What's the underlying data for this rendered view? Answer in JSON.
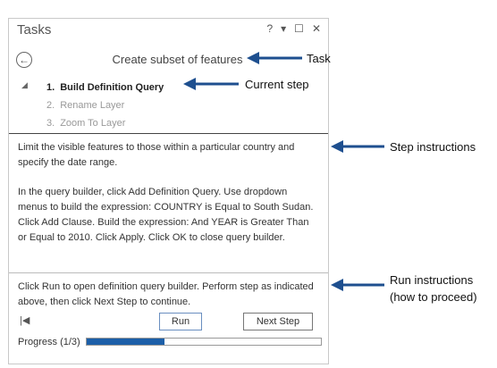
{
  "pane": {
    "title": "Tasks",
    "controls": {
      "help": "?",
      "menu": "▾",
      "maximize": "☐",
      "close": "✕"
    },
    "back_glyph": "←",
    "task_title": "Create subset of features",
    "steps": [
      {
        "number": "1.",
        "label": "Build Definition Query"
      },
      {
        "number": "2.",
        "label": "Rename Layer"
      },
      {
        "number": "3.",
        "label": "Zoom To Layer"
      }
    ],
    "current_step": 1,
    "instructions": [
      "Limit the visible features to those within a particular country and specify the date range.",
      "In the query builder, click Add Definition Query. Use dropdown menus to build the expression: COUNTRY is Equal to South Sudan. Click Add Clause. Build the expression: And YEAR is Greater Than or Equal to 2010. Click Apply. Click OK to close query builder."
    ],
    "run_instructions": "Click Run to open definition query builder. Perform step as indicated above, then click Next Step to continue.",
    "run_label": "Run",
    "next_label": "Next Step",
    "progress_label": "Progress (1/3)",
    "progress_fraction": 0.333
  },
  "callouts": {
    "task": "Task",
    "current_step": "Current step",
    "step_instructions": "Step instructions",
    "run_instructions_line1": "Run instructions",
    "run_instructions_line2": "(how to proceed)"
  },
  "colors": {
    "arrow": "#1e4f8f",
    "progress": "#1c5fa8"
  }
}
